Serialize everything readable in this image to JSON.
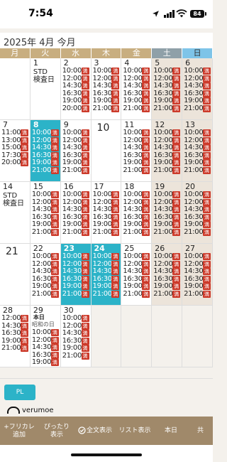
{
  "status": {
    "time": "7:54",
    "battery": "84"
  },
  "title": "2025年 4月 今月",
  "weekdays": [
    "月",
    "火",
    "水",
    "木",
    "金",
    "土",
    "日"
  ],
  "weeks": [
    [
      {
        "empty": true
      },
      {
        "day": "1",
        "note": "STD\n検査日"
      },
      {
        "day": "2",
        "slots": [
          "10:00",
          "12:00",
          "14:30",
          "16:30",
          "19:00",
          "20:00"
        ],
        "badges": true
      },
      {
        "day": "3",
        "slots": [
          "10:00",
          "12:00",
          "14:30",
          "16:30",
          "19:00",
          "21:00"
        ],
        "badges": true
      },
      {
        "day": "4",
        "slots": [
          "10:00",
          "12:00",
          "14:30",
          "16:30",
          "19:00",
          "21:00"
        ],
        "badges": true
      },
      {
        "day": "5",
        "weekend": true,
        "slots": [
          "10:00",
          "12:00",
          "14:30",
          "16:30",
          "19:00",
          "21:00"
        ],
        "badges": true
      },
      {
        "day": "6",
        "weekend": true,
        "slots": [
          "10:00",
          "12:00",
          "14:30",
          "16:30",
          "19:00",
          "21:00"
        ],
        "badges": true
      }
    ],
    [
      {
        "day": "7",
        "slots": [
          "11:00",
          "13:00",
          "15:00",
          "17:30",
          "20:00"
        ],
        "badges": true,
        "offset": 1
      },
      {
        "day": "8",
        "selected": true,
        "slots": [
          "10:00",
          "12:00",
          "14:30",
          "16:30",
          "19:00",
          "21:00"
        ],
        "badges": true
      },
      {
        "day": "9",
        "slots": [
          "10:00",
          "12:00",
          "14:30",
          "16:30",
          "19:00",
          "21:00"
        ],
        "badges": true
      },
      {
        "day": "10",
        "big": true
      },
      {
        "day": "11",
        "slots": [
          "10:00",
          "12:00",
          "14:30",
          "16:30",
          "19:00",
          "21:00"
        ],
        "badges": true
      },
      {
        "day": "12",
        "weekend": true,
        "slots": [
          "10:00",
          "12:00",
          "14:30",
          "16:30",
          "19:00",
          "21:00"
        ],
        "badges": true
      },
      {
        "day": "13",
        "weekend": true,
        "slots": [
          "10:00",
          "12:00",
          "14:30",
          "16:30",
          "19:00",
          "21:00"
        ],
        "badges": true
      }
    ],
    [
      {
        "day": "14",
        "note": "STD\n検査日"
      },
      {
        "day": "15",
        "slots": [
          "10:00",
          "12:00",
          "14:30",
          "16:30",
          "19:00",
          "21:00"
        ],
        "badges": true
      },
      {
        "day": "16",
        "slots": [
          "10:00",
          "12:00",
          "14:30",
          "16:30",
          "19:00",
          "21:00"
        ],
        "badges": true
      },
      {
        "day": "17",
        "slots": [
          "10:00",
          "12:00",
          "14:30",
          "16:30",
          "19:00",
          "21:00"
        ],
        "badges": true
      },
      {
        "day": "18",
        "slots": [
          "10:00",
          "12:00",
          "14:30",
          "16:30",
          "19:00",
          "21:00"
        ],
        "badges": true
      },
      {
        "day": "19",
        "weekend": true,
        "slots": [
          "10:00",
          "12:00",
          "14:30",
          "16:30",
          "19:00",
          "21:00"
        ],
        "badges": true
      },
      {
        "day": "20",
        "weekend": true,
        "slots": [
          "10:00",
          "12:00",
          "14:30",
          "16:30",
          "19:00",
          "21:00"
        ],
        "badges": true
      }
    ],
    [
      {
        "day": "21",
        "big": true
      },
      {
        "day": "22",
        "slots": [
          "10:00",
          "12:00",
          "14:30",
          "16:30",
          "19:00",
          "21:00"
        ],
        "badges": true
      },
      {
        "day": "23",
        "selected": true,
        "slots": [
          "10:00",
          "12:00",
          "14:30",
          "16:30",
          "19:00",
          "21:00"
        ],
        "badges": true
      },
      {
        "day": "24",
        "selected": true,
        "slots": [
          "10:00",
          "12:00",
          "14:30",
          "16:30",
          "19:00",
          "21:00"
        ],
        "badges": true
      },
      {
        "day": "25",
        "slots": [
          "10:00",
          "12:00",
          "14:30",
          "16:30",
          "19:00",
          "21:00"
        ],
        "badges": true
      },
      {
        "day": "26",
        "weekend": true,
        "slots": [
          "10:00",
          "12:00",
          "14:30",
          "16:30",
          "19:00",
          "21:00"
        ],
        "badges": true
      },
      {
        "day": "27",
        "weekend": true,
        "slots": [
          "10:00",
          "12:00",
          "14:30",
          "16:30",
          "19:00",
          "21:00"
        ],
        "badges": true
      }
    ],
    [
      {
        "day": "28",
        "slots": [
          "12:00",
          "14:30",
          "16:30",
          "19:00",
          "21:00"
        ],
        "badges": true
      },
      {
        "day": "29",
        "today": "本日",
        "holiday": "昭和の日",
        "slots": [
          "10:00",
          "12:00",
          "14:30",
          "16:30",
          "19:00",
          "21:00"
        ],
        "badges": true
      },
      {
        "day": "30",
        "slots": [
          "10:00",
          "12:00",
          "14:30",
          "16:30",
          "19:00",
          "21:00"
        ],
        "badges": true
      },
      {
        "gray": true
      },
      {
        "gray": true
      },
      {
        "gray": true
      },
      {
        "gray": true
      }
    ]
  ],
  "badge_label": "満",
  "pl_label": "PL",
  "brand": "verumoe",
  "toolbar": {
    "add": "+フリカレ\n追加",
    "fit": "ぴったり\n表示",
    "full": "全文表示",
    "list": "リスト表示",
    "today": "本日",
    "share": "共"
  }
}
